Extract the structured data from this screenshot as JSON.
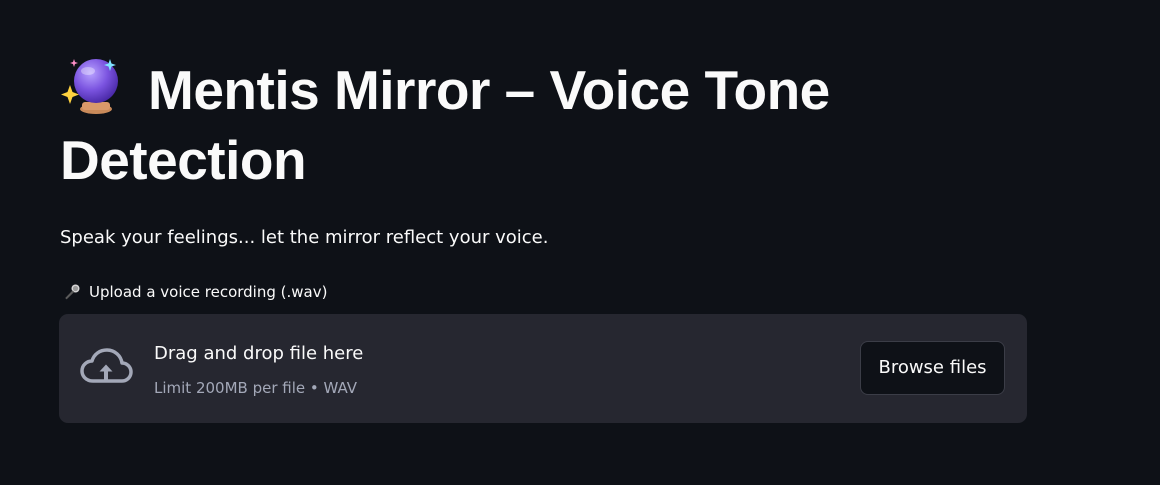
{
  "header": {
    "title": "Mentis Mirror – Voice Tone Detection",
    "title_icon": "crystal-ball-icon"
  },
  "main": {
    "subtitle": "Speak your feelings... let the mirror reflect your voice."
  },
  "uploader": {
    "label": "Upload a voice recording (.wav)",
    "label_icon": "microphone-icon",
    "dropzone_icon": "cloud-upload-icon",
    "drop_text": "Drag and drop file here",
    "limit_text": "Limit 200MB per file • WAV",
    "browse_label": "Browse files"
  },
  "colors": {
    "background": "#0e1117",
    "dropzone_background": "#262730",
    "text": "#fafafa",
    "muted_text": "#a3a8b8"
  }
}
